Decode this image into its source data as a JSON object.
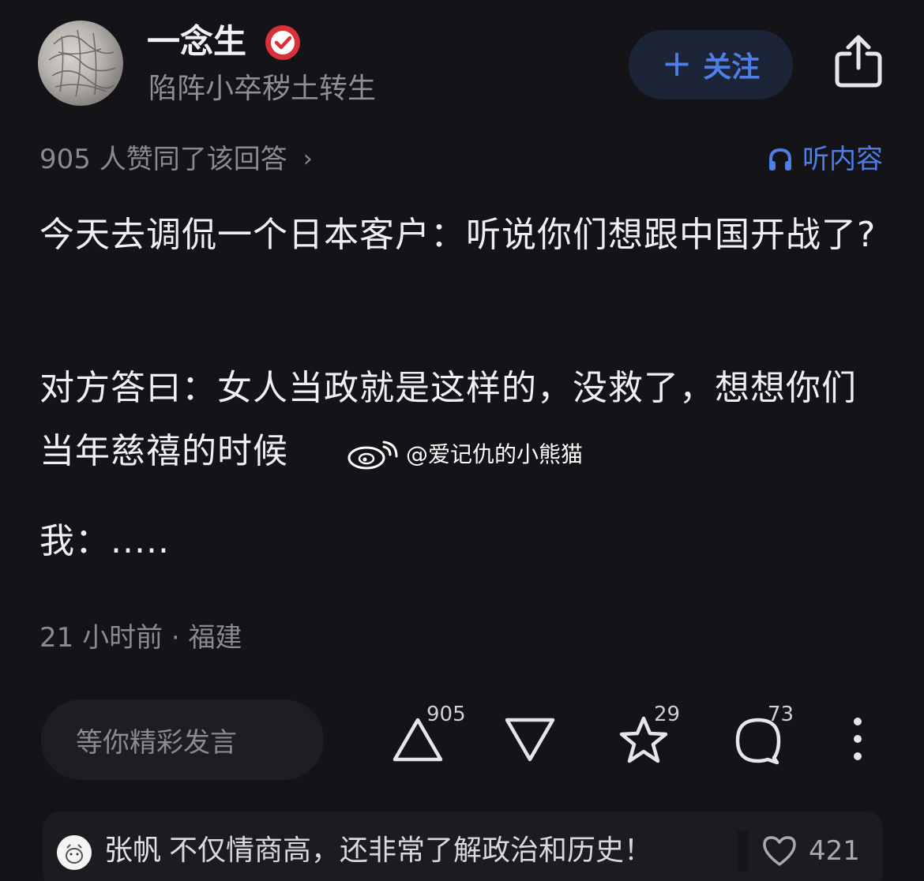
{
  "author": {
    "name": "一念生",
    "subtitle": "陷阵小卒秽土转生"
  },
  "follow_button": {
    "label": "关注"
  },
  "agree": {
    "text": "905 人赞同了该回答",
    "chevron": "›"
  },
  "listen": {
    "label": "听内容",
    "icon": "headphones-icon"
  },
  "content": {
    "paragraphs": [
      "今天去调侃一个日本客户：听说你们想跟中国开战了?",
      "对方答曰：女人当政就是这样的，没救了，想想你们当年慈禧的时候",
      "我：....."
    ]
  },
  "watermark": {
    "text": "@爱记仇的小熊猫",
    "icon": "weibo-icon"
  },
  "meta": {
    "time_location": "21 小时前 · 福建"
  },
  "action_bar": {
    "comment_placeholder": "等你精彩发言",
    "upvote_count": "905",
    "star_count": "29",
    "comment_count": "73"
  },
  "hot_comment": {
    "user": "张帆",
    "text": "不仅情商高，还非常了解政治和历史！",
    "likes": "421"
  },
  "colors": {
    "background": "#131318",
    "accent_blue": "#4f7fe6",
    "verify_red": "#d9303a"
  }
}
